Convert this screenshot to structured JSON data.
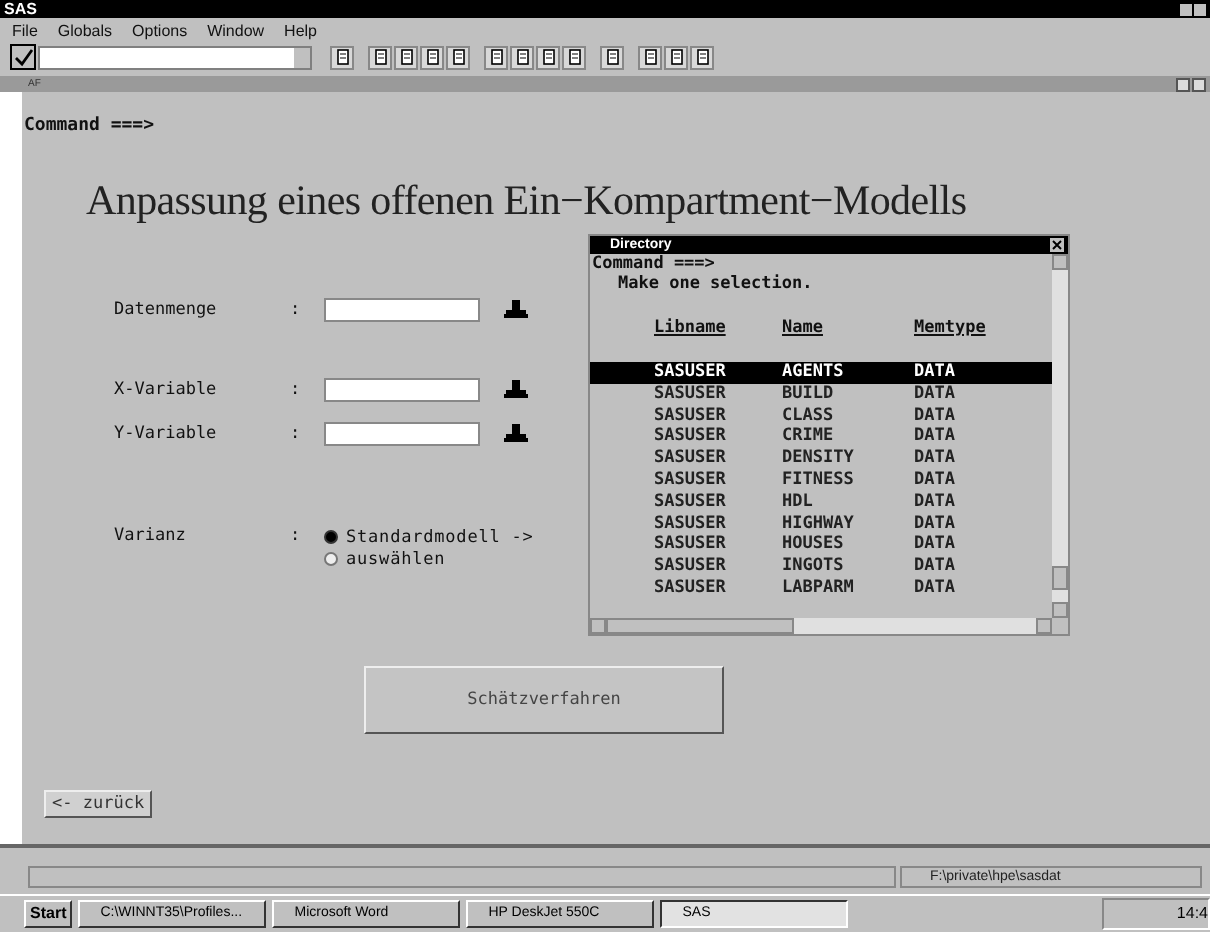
{
  "window": {
    "title": "SAS"
  },
  "menu": [
    {
      "label": "File"
    },
    {
      "label": "Globals"
    },
    {
      "label": "Options"
    },
    {
      "label": "Window"
    },
    {
      "label": "Help"
    }
  ],
  "af_window": {
    "title": "AF",
    "command": "Command ===>",
    "heading": "Anpassung eines offenen Ein−Kompartment−Modells",
    "fields": [
      {
        "label": "Datenmenge",
        "colon": ":"
      },
      {
        "label": "X-Variable",
        "colon": ":"
      },
      {
        "label": "Y-Variable",
        "colon": ":"
      }
    ],
    "varianz": {
      "label": "Varianz",
      "colon": ":",
      "options": [
        {
          "label": "Standardmodell ->",
          "selected": true
        },
        {
          "label": "auswählen",
          "selected": false
        }
      ]
    },
    "action_button": "Schätzverfahren",
    "back_button": "<- zurück"
  },
  "directory": {
    "title": "Directory",
    "command": "Command ===>",
    "prompt": "Make one selection.",
    "columns": [
      "Libname",
      "Name",
      "Memtype"
    ],
    "rows": [
      {
        "cells": [
          "SASUSER",
          "AGENTS",
          "DATA"
        ],
        "selected": true
      },
      {
        "cells": [
          "SASUSER",
          "BUILD",
          "DATA"
        ],
        "selected": false
      },
      {
        "cells": [
          "SASUSER",
          "CLASS",
          "DATA"
        ],
        "selected": false
      },
      {
        "cells": [
          "SASUSER",
          "CRIME",
          "DATA"
        ],
        "selected": false
      },
      {
        "cells": [
          "SASUSER",
          "DENSITY",
          "DATA"
        ],
        "selected": false
      },
      {
        "cells": [
          "SASUSER",
          "FITNESS",
          "DATA"
        ],
        "selected": false
      },
      {
        "cells": [
          "SASUSER",
          "HDL",
          "DATA"
        ],
        "selected": false
      },
      {
        "cells": [
          "SASUSER",
          "HIGHWAY",
          "DATA"
        ],
        "selected": false
      },
      {
        "cells": [
          "SASUSER",
          "HOUSES",
          "DATA"
        ],
        "selected": false
      },
      {
        "cells": [
          "SASUSER",
          "INGOTS",
          "DATA"
        ],
        "selected": false
      },
      {
        "cells": [
          "SASUSER",
          "LABPARM",
          "DATA"
        ],
        "selected": false
      }
    ]
  },
  "status_bar": {
    "path": "F:\\private\\hpe\\sasdat"
  },
  "taskbar": {
    "start": "Start",
    "tasks": [
      {
        "label": "C:\\WINNT35\\Profiles...",
        "selected": false
      },
      {
        "label": "Microsoft Word",
        "selected": false
      },
      {
        "label": "HP DeskJet 550C",
        "selected": false
      },
      {
        "label": "SAS",
        "selected": true
      }
    ],
    "clock": "14:4"
  }
}
